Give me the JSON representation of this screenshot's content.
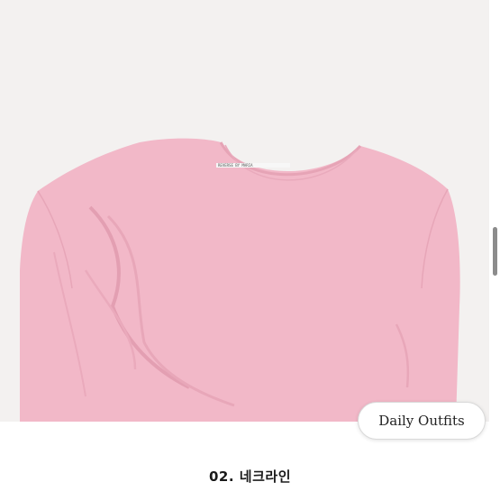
{
  "photo": {
    "tag_text": "REVERSE BY MARIA",
    "garment_color": "#f2b8c8",
    "background_color": "#f3f1f0"
  },
  "button": {
    "label": "Daily Outfits"
  },
  "caption": {
    "text": "02. 네크라인"
  },
  "scrollbar": {
    "position": 0.5
  }
}
